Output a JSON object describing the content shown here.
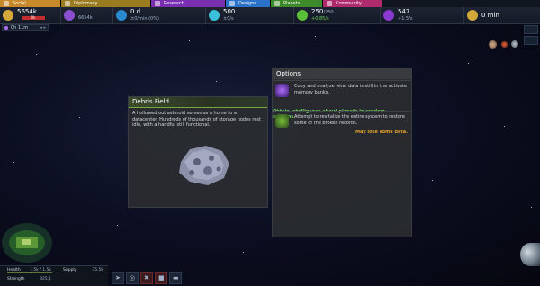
{
  "tabs": [
    {
      "label": "Social",
      "color": "#c8892a"
    },
    {
      "label": "Diplomacy",
      "color": "#9a7b1f"
    },
    {
      "label": "Research",
      "color": "#7a2fb0"
    },
    {
      "label": "Designs",
      "color": "#2a73c8"
    },
    {
      "label": "Planets",
      "color": "#3c8a2a"
    },
    {
      "label": "Community",
      "color": "#b02a6e"
    }
  ],
  "resources": {
    "money": {
      "value": "5654k",
      "bar": "0k",
      "icon": "money-icon",
      "color": "#d4a73a"
    },
    "influence": {
      "value": "6654k",
      "icon": "influence-icon",
      "color": "#8a4fd0"
    },
    "research": {
      "value": "0 d",
      "sub": "±0/min (0%)",
      "icon": "research-icon",
      "color": "#2a8ad0"
    },
    "energy": {
      "value": "500",
      "sub": "±0/s",
      "icon": "energy-icon",
      "color": "#3ac0d8"
    },
    "growth": {
      "value": "250",
      "value_small": "/250",
      "sub": "+0.85/s",
      "icon": "growth-icon",
      "color": "#5ac03a"
    },
    "dark_matter": {
      "value": "547",
      "sub": "+1.5/s",
      "icon": "dark-matter-icon",
      "color": "#8a3ad0"
    },
    "time": {
      "value": "0 min",
      "icon": "time-icon",
      "color": "#d4a73a"
    }
  },
  "timer": {
    "label": "0h 11m"
  },
  "debris_panel": {
    "title": "Debris Field",
    "description": "A hollowed out asteroid serves as a home to a datacenter. Hundreds of thousands of storage nodes rest idle, with a handful still functional."
  },
  "options_panel": {
    "title": "Options",
    "options": [
      {
        "text": "Copy and analyze what data is still in the activate memory banks.",
        "effect": "Obtain intelligence about planets in random systems.",
        "effect_color": "#6fd35b",
        "icon": "intelligence-icon"
      },
      {
        "text": "Attempt to revitalize the entire system to restore some of the broken records.",
        "effect": "May lose some data.",
        "effect_color": "#e0a030",
        "icon": "repair-icon"
      }
    ]
  },
  "stats": {
    "health": {
      "label": "Health",
      "value": "1.5k / 1.5k"
    },
    "supply": {
      "label": "Supply",
      "value": "35.5k"
    },
    "strength": {
      "label": "Strength",
      "value": "925.1"
    }
  }
}
